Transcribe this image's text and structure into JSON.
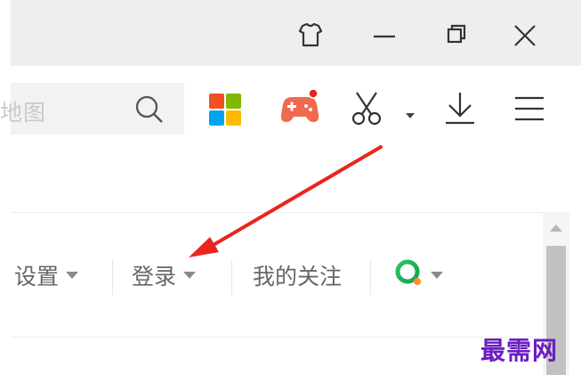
{
  "search": {
    "text": "地图"
  },
  "bookmarks": {
    "settings_label": "设置",
    "login_label": "登录",
    "follow_label": "我的关注"
  },
  "watermark": "最需网",
  "colors": {
    "arrow": "#e8261f",
    "game_icon": "#f06a4e",
    "apps_red": "#f25022",
    "apps_green": "#7fba00",
    "apps_blue": "#00a4ef",
    "apps_yellow": "#ffb900",
    "watermark": "#6a1cc4"
  },
  "icons": [
    "skin-icon",
    "minimize-icon",
    "restore-icon",
    "close-icon",
    "search-icon",
    "apps-icon",
    "game-icon",
    "scissors-icon",
    "download-icon",
    "menu-icon",
    "quark-icon"
  ]
}
